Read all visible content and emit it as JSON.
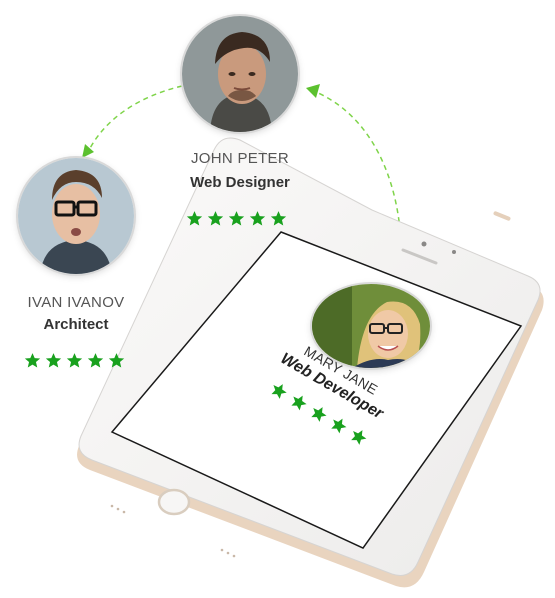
{
  "colors": {
    "accent_green": "#19a11e",
    "dashed_arrow": "#7fd44a",
    "phone_body": "#f4f2f1",
    "phone_trim": "#e8d3bf"
  },
  "profiles": [
    {
      "name": "JOHN PETER",
      "role": "Web Designer",
      "rating": 5
    },
    {
      "name": "IVAN IVANOV",
      "role": "Architect",
      "rating": 5
    },
    {
      "name": "MARY JANE",
      "role": "Web Developer",
      "rating": 5
    }
  ],
  "icons": {
    "star": "star-icon",
    "arrow": "arrow-head-icon"
  }
}
